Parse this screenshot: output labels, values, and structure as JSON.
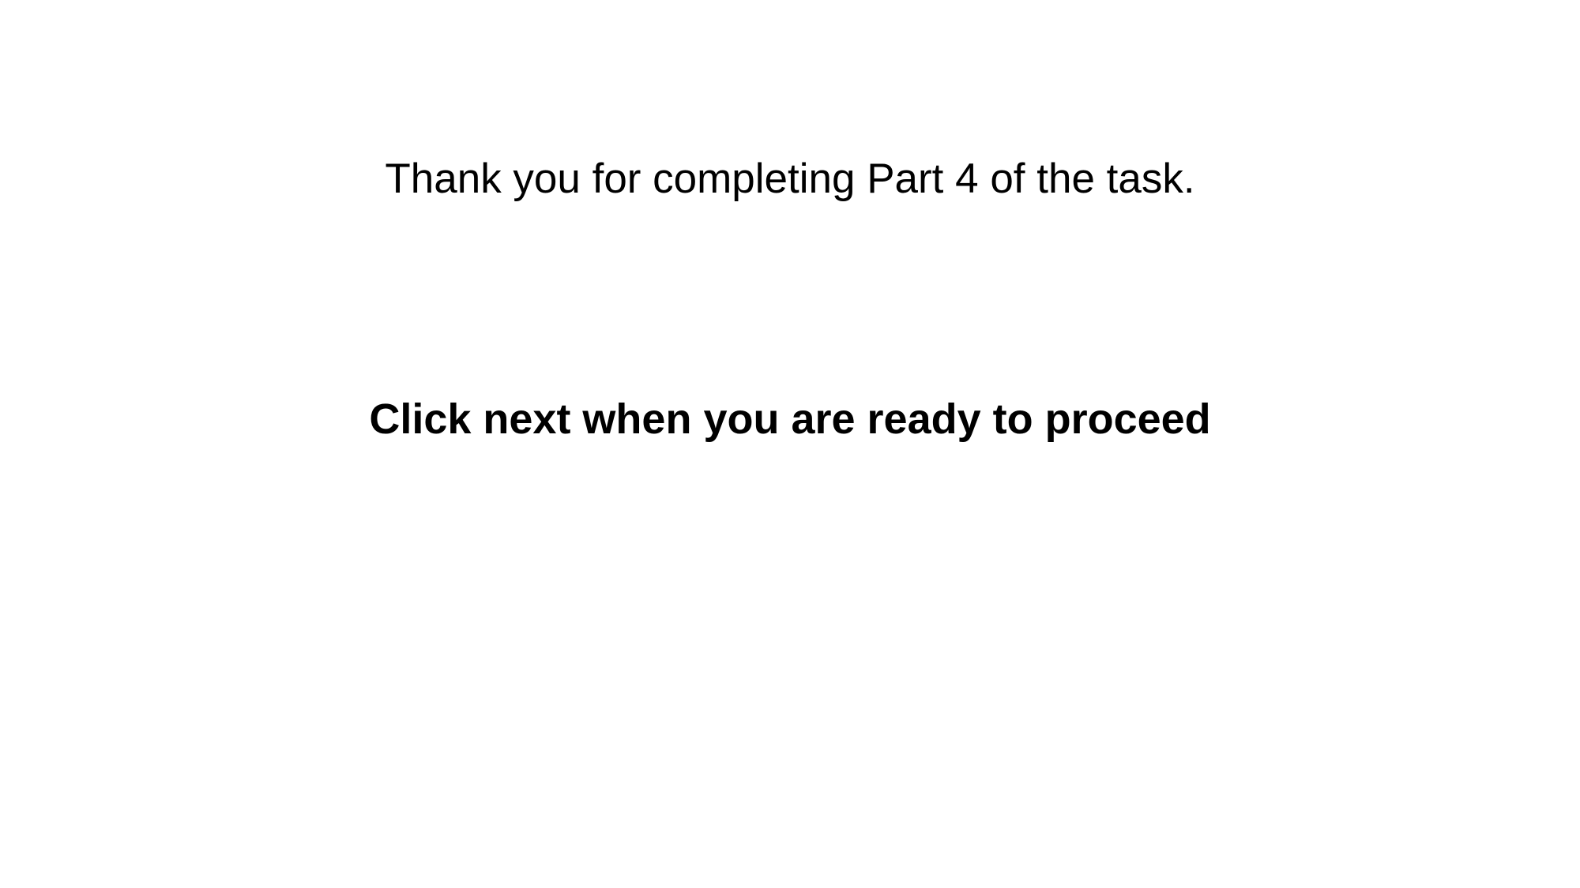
{
  "screen": {
    "message": "Thank you for completing Part 4 of the task.",
    "instruction": "Click next when you are ready to proceed"
  },
  "colors": {
    "background": "#ffffff",
    "text": "#000000"
  }
}
